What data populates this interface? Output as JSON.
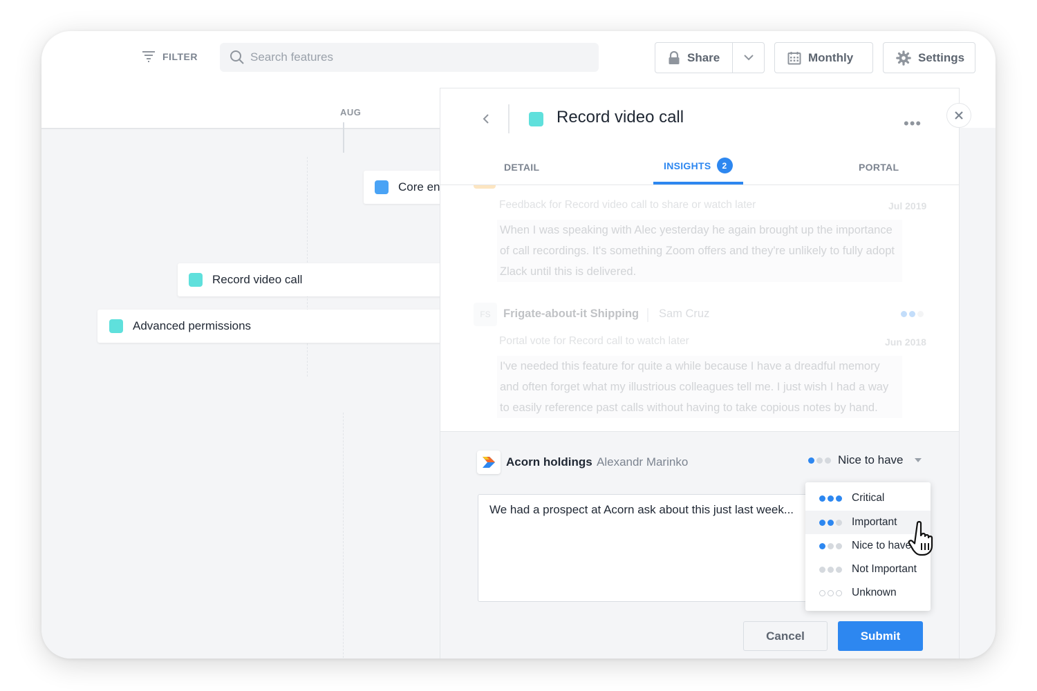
{
  "toolbar": {
    "filter_label": "FILTER",
    "search_placeholder": "Search features",
    "share_label": "Share",
    "monthly_label": "Monthly",
    "settings_label": "Settings"
  },
  "timeline": {
    "month_label": "AUG",
    "features": [
      {
        "label": "Core en",
        "color": "#4aa3f5"
      },
      {
        "label": "Record video call",
        "color": "#5fe0dc"
      },
      {
        "label": "Advanced permissions",
        "color": "#5fe0dc"
      }
    ]
  },
  "panel": {
    "title": "Record video call",
    "title_color": "#5fe0dc",
    "more": "•••",
    "tabs": [
      {
        "label": "DETAIL",
        "active": false
      },
      {
        "label": "INSIGHTS",
        "active": true,
        "badge": "2"
      },
      {
        "label": "PORTAL",
        "active": false
      }
    ],
    "insights": [
      {
        "subtitle": "Feedback for Record video call to share or watch later",
        "date": "Jul 2019",
        "lines": [
          "When I was speaking with Alec yesterday he again brought up the importance",
          "of call recordings. It's something Zoom offers and they're unlikely to fully adopt",
          "Zlack until this is delivered."
        ]
      },
      {
        "avatar": "FS",
        "company": "Frigate-about-it Shipping",
        "person": "Sam Cruz",
        "subtitle": "Portal vote for Record call to watch later",
        "date": "Jun 2018",
        "lines": [
          "I've needed this feature for quite a while because I have a dreadful memory",
          "and often forget what my illustrious colleagues tell me. I just wish I had a way",
          "to easily reference past calls without having to take copious notes by hand."
        ]
      }
    ],
    "composer": {
      "company": "Acorn holdings",
      "person": "Alexandr Marinko",
      "priority": "Nice to have",
      "note": "We had a prospect at Acorn ask about this just last week...",
      "options": [
        {
          "label": "Critical",
          "filled": 3
        },
        {
          "label": "Important",
          "filled": 2
        },
        {
          "label": "Nice to have",
          "filled": 1
        },
        {
          "label": "Not Important",
          "filled": 0
        },
        {
          "label": "Unknown",
          "filled": -1
        }
      ],
      "cancel_label": "Cancel",
      "submit_label": "Submit"
    }
  },
  "colors": {
    "accent": "#2d87f0",
    "teal": "#5fe0dc",
    "blue_swatch": "#4aa3f5",
    "orange_strip": "#f5a623"
  }
}
